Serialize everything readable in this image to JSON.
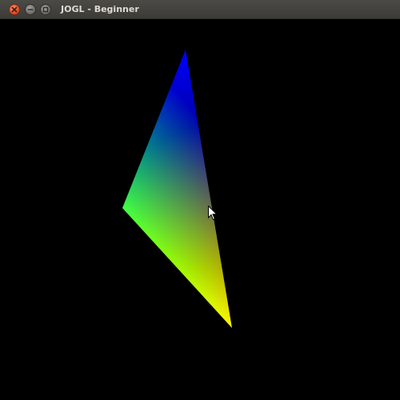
{
  "window": {
    "title": "JOGL - Beginner"
  },
  "controls": {
    "close": "close-icon",
    "minimize": "minimize-icon",
    "maximize": "maximize-icon"
  },
  "scene": {
    "background": "#000000",
    "vertex_colors": [
      "#0000ff",
      "#00ff00",
      "#ff0000"
    ]
  },
  "cursor": {
    "icon": "mouse-pointer-icon"
  }
}
